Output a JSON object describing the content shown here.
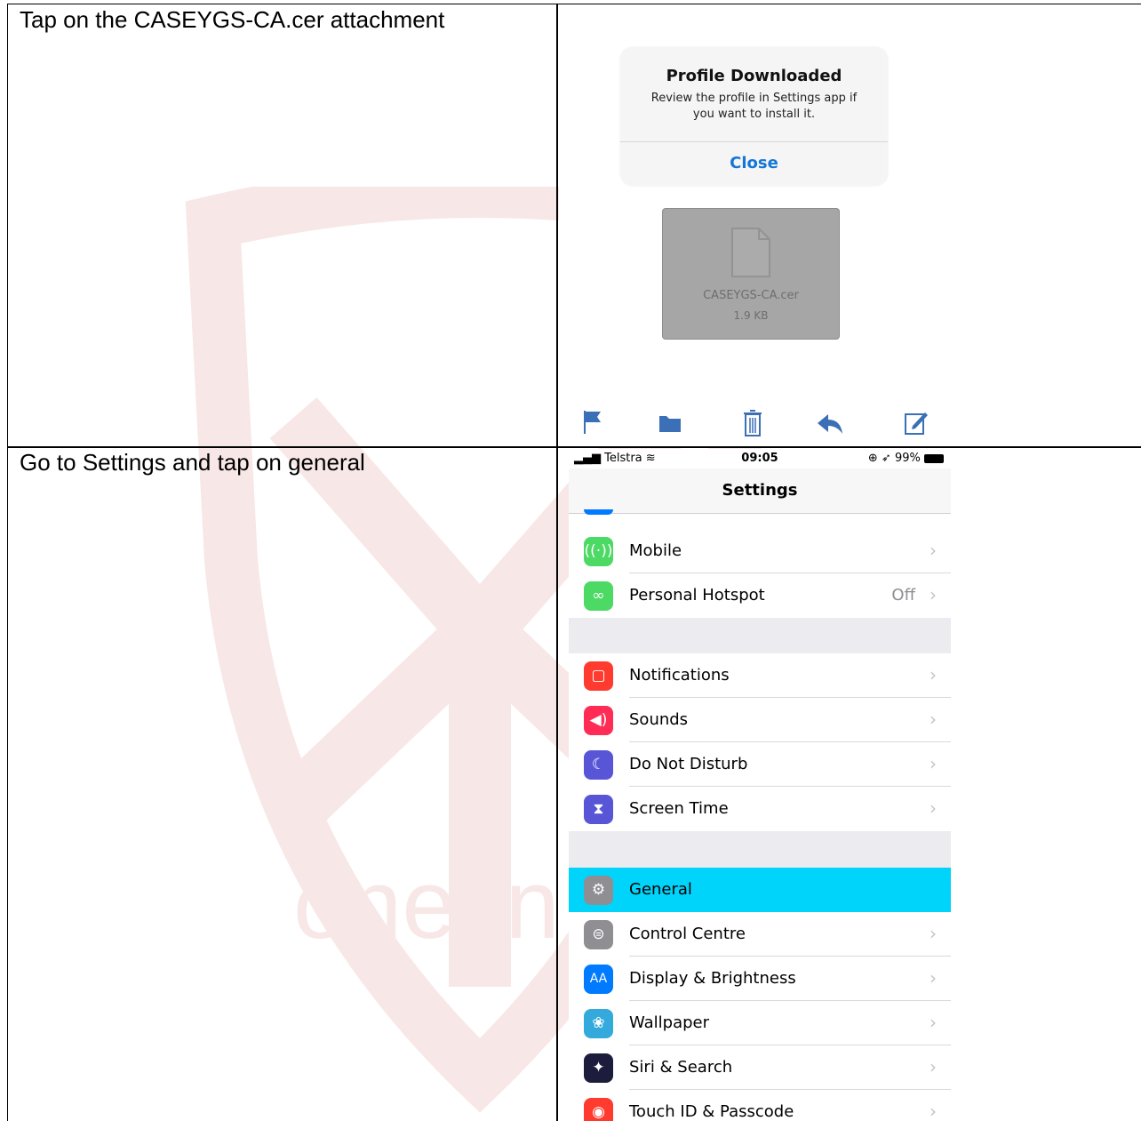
{
  "instructions": [
    "Tap on the CASEYGS-CA.cer attachment",
    "Go to Settings and tap on general"
  ],
  "mail_screen": {
    "alert": {
      "title": "Profile Downloaded",
      "message": "Review the profile in Settings app if you want to install it.",
      "button": "Close"
    },
    "attachment": {
      "name": "CASEYGS-CA.cer",
      "size": "1.9 KB"
    },
    "toolbar_icons": [
      "flag-icon",
      "folder-icon",
      "trash-icon",
      "reply-icon",
      "compose-icon"
    ]
  },
  "settings_screen": {
    "status_bar": {
      "carrier": "Telstra",
      "time": "09:05",
      "battery": "99%"
    },
    "title": "Settings",
    "rows": [
      {
        "label": "Mobile",
        "value": "",
        "icon": "antenna-icon",
        "color": "#4cd964"
      },
      {
        "label": "Personal Hotspot",
        "value": "Off",
        "icon": "hotspot-icon",
        "color": "#4cd964"
      },
      {
        "label": "Notifications",
        "value": "",
        "icon": "notifications-icon",
        "color": "#ff3b30"
      },
      {
        "label": "Sounds",
        "value": "",
        "icon": "speaker-icon",
        "color": "#ff2d55"
      },
      {
        "label": "Do Not Disturb",
        "value": "",
        "icon": "moon-icon",
        "color": "#5856d6"
      },
      {
        "label": "Screen Time",
        "value": "",
        "icon": "hourglass-icon",
        "color": "#5856d6"
      },
      {
        "label": "General",
        "value": "",
        "icon": "gear-icon",
        "color": "#8e8e93",
        "highlighted": true
      },
      {
        "label": "Control Centre",
        "value": "",
        "icon": "toggles-icon",
        "color": "#8e8e93"
      },
      {
        "label": "Display & Brightness",
        "value": "",
        "icon": "text-size-icon",
        "color": "#007aff"
      },
      {
        "label": "Wallpaper",
        "value": "",
        "icon": "flower-icon",
        "color": "#34aadc"
      },
      {
        "label": "Siri & Search",
        "value": "",
        "icon": "siri-icon",
        "color": "#1c1c3c"
      },
      {
        "label": "Touch ID & Passcode",
        "value": "",
        "icon": "fingerprint-icon",
        "color": "#ff3b30"
      }
    ]
  }
}
